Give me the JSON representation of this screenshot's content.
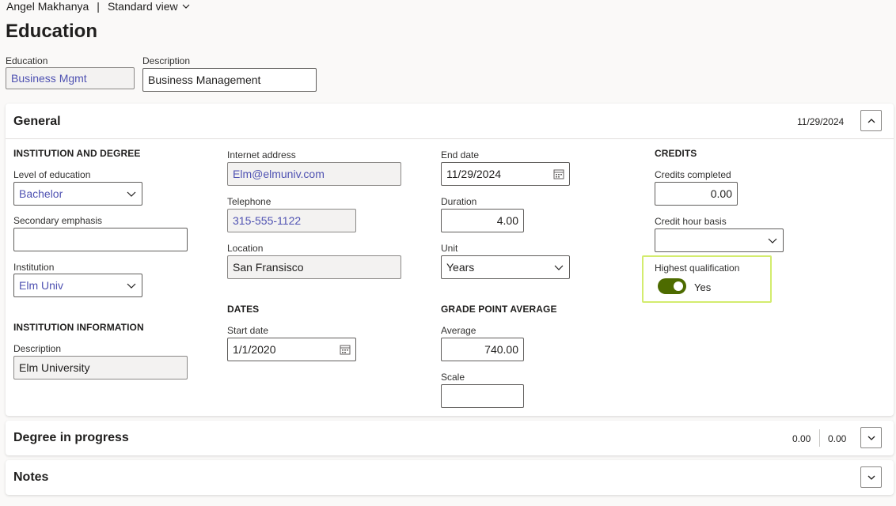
{
  "breadcrumb": {
    "user": "Angel Makhanya",
    "separator": "|",
    "view": "Standard view"
  },
  "page": {
    "title": "Education"
  },
  "header_fields": {
    "education": {
      "label": "Education",
      "value": "Business Mgmt"
    },
    "description": {
      "label": "Description",
      "value": "Business Management"
    }
  },
  "general": {
    "title": "General",
    "summary": "11/29/2024",
    "institution_and_degree": {
      "heading": "INSTITUTION AND DEGREE",
      "level_of_education": {
        "label": "Level of education",
        "value": "Bachelor"
      },
      "secondary_emphasis": {
        "label": "Secondary emphasis",
        "value": ""
      },
      "institution": {
        "label": "Institution",
        "value": "Elm Univ"
      }
    },
    "institution_information": {
      "heading": "INSTITUTION INFORMATION",
      "description": {
        "label": "Description",
        "value": "Elm University"
      }
    },
    "contact": {
      "internet_address": {
        "label": "Internet address",
        "value": "Elm@elmuniv.com"
      },
      "telephone": {
        "label": "Telephone",
        "value": "315-555-1122"
      },
      "location": {
        "label": "Location",
        "value": "San Fransisco"
      }
    },
    "dates": {
      "heading": "DATES",
      "start_date": {
        "label": "Start date",
        "value": "1/1/2020"
      }
    },
    "period": {
      "end_date": {
        "label": "End date",
        "value": "11/29/2024"
      },
      "duration": {
        "label": "Duration",
        "value": "4.00"
      },
      "unit": {
        "label": "Unit",
        "value": "Years"
      }
    },
    "grade_point_average": {
      "heading": "GRADE POINT AVERAGE",
      "average": {
        "label": "Average",
        "value": "740.00"
      },
      "scale": {
        "label": "Scale",
        "value": ""
      }
    },
    "credits": {
      "heading": "CREDITS",
      "credits_completed": {
        "label": "Credits completed",
        "value": "0.00"
      },
      "credit_hour_basis": {
        "label": "Credit hour basis",
        "value": ""
      },
      "highest_qualification": {
        "label": "Highest qualification",
        "value": "Yes"
      }
    }
  },
  "degree_in_progress": {
    "title": "Degree in progress",
    "summary_1": "0.00",
    "summary_2": "0.00"
  },
  "notes": {
    "title": "Notes"
  },
  "colors": {
    "accent_link": "#4f52b2",
    "toggle_on": "#4d6b00",
    "highlight_border": "#d3ec6e",
    "readonly_bg": "#f3f2f1"
  }
}
